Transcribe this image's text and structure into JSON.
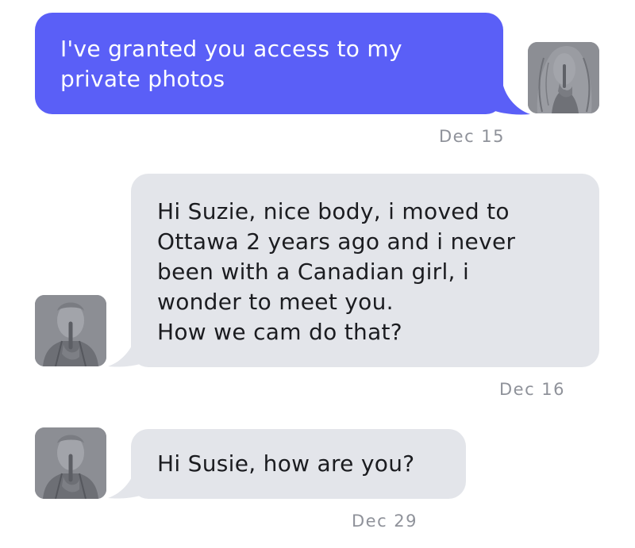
{
  "messages": [
    {
      "direction": "sent",
      "text": "I've granted you access to my\nprivate photos",
      "date": "Dec 15",
      "avatar_icon": "woman-shush-avatar-icon"
    },
    {
      "direction": "received",
      "text": "Hi Suzie, nice body, i moved to\nOttawa 2 years ago and i never\nbeen with a Canadian girl, i\nwonder to meet you.\nHow we cam do that?",
      "date": "Dec 16",
      "avatar_icon": "man-shush-avatar-icon"
    },
    {
      "direction": "received",
      "text": "Hi Susie, how are you?",
      "date": "Dec 29",
      "avatar_icon": "man-shush-avatar-icon"
    }
  ],
  "colors": {
    "sent_bubble": "#5a5ff7",
    "received_bubble": "#e3e5ea",
    "timestamp": "#8f929a"
  }
}
